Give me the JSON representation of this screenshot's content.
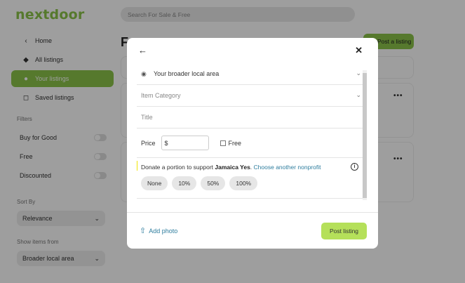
{
  "app": {
    "logo": "nextdoor",
    "search_placeholder": "Search For Sale & Free",
    "page_title": "F",
    "post_listing_bg": "Post a listing"
  },
  "sidebar": {
    "home": "Home",
    "items": [
      {
        "label": "All listings",
        "icon": "tag-icon"
      },
      {
        "label": "Your listings",
        "icon": "person-icon",
        "active": true
      },
      {
        "label": "Saved listings",
        "icon": "bookmark-icon"
      }
    ],
    "filters_label": "Filters",
    "filters": [
      "Buy for Good",
      "Free",
      "Discounted"
    ],
    "sort_label": "Sort By",
    "sort_value": "Relevance",
    "show_label": "Show items from",
    "show_value": "Broader local area"
  },
  "modal": {
    "location": "Your broader local area",
    "category_placeholder": "Item Category",
    "title_placeholder": "Title",
    "price_label": "Price",
    "price_prefix": "$",
    "free_label": "Free",
    "donate_prefix": "Donate a portion to support ",
    "donate_org": "Jamaica Yes",
    "donate_sep": ". ",
    "donate_link": "Choose another nonprofit",
    "amounts": [
      "None",
      "10%",
      "50%",
      "100%"
    ],
    "add_photo": "Add photo",
    "post_button": "Post listing"
  },
  "colors": {
    "brand": "#8bc34a",
    "post_button": "#b5e05a",
    "link": "#2e7d9e",
    "highlight": "#f2e600"
  }
}
